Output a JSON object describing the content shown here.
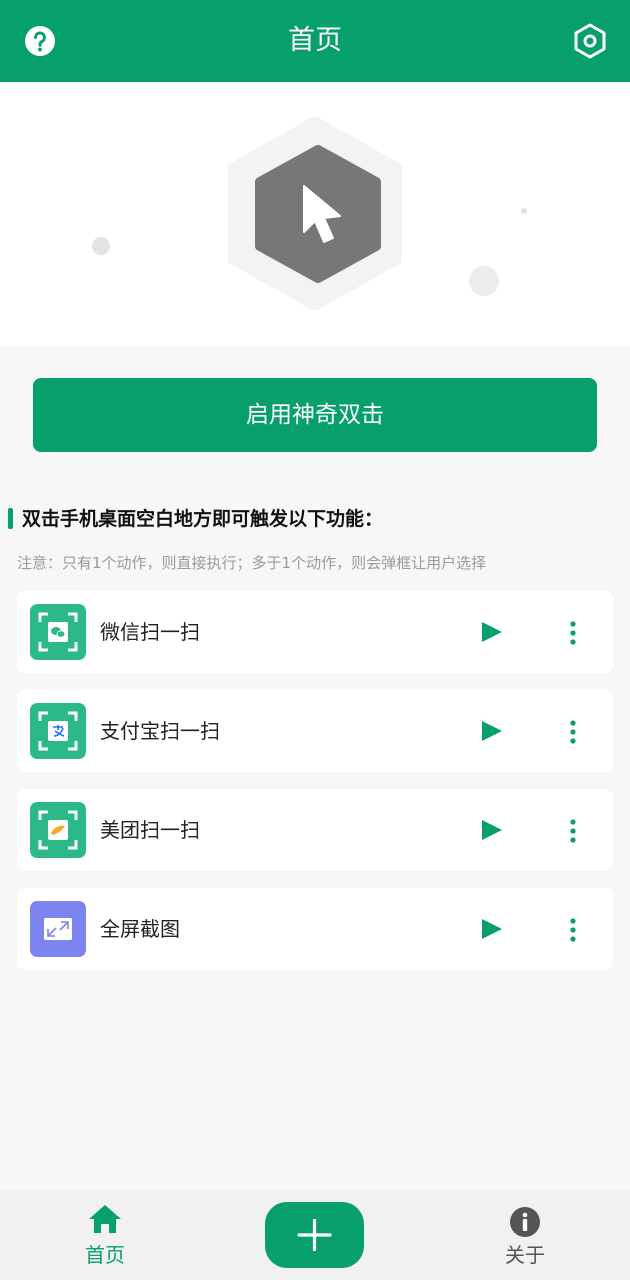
{
  "header": {
    "title": "首页",
    "help_icon": "help-circle-icon",
    "settings_icon": "hexagon-settings-icon"
  },
  "hero": {
    "icon": "hexagon-cursor-icon"
  },
  "enable_button": {
    "label": "启用神奇双击"
  },
  "section": {
    "title": "双击手机桌面空白地方即可触发以下功能：",
    "note": "注意：只有1个动作，则直接执行；多于1个动作，则会弹框让用户选择"
  },
  "actions": [
    {
      "name": "微信扫一扫",
      "icon": "wechat-scan-icon",
      "color": "#2cb98a"
    },
    {
      "name": "支付宝扫一扫",
      "icon": "alipay-scan-icon",
      "color": "#2cb98a"
    },
    {
      "name": "美团扫一扫",
      "icon": "meituan-scan-icon",
      "color": "#2cb98a"
    },
    {
      "name": "全屏截图",
      "icon": "fullscreen-screenshot-icon",
      "color": "#7d84ef"
    }
  ],
  "bottom_nav": {
    "home_label": "首页",
    "about_label": "关于",
    "add_icon": "plus-icon"
  },
  "colors": {
    "primary": "#07a06a",
    "background": "#f7f7f7"
  }
}
